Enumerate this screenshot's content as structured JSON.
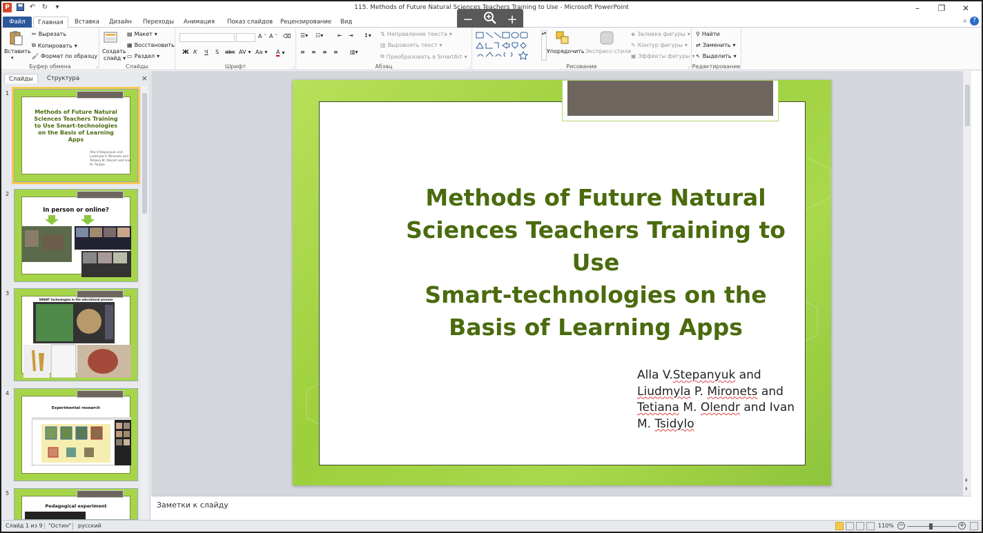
{
  "window": {
    "title": "115. Methods of Future Natural Sciences Teachers Training to Use - Microsoft PowerPoint",
    "app_icon": "P"
  },
  "zoom_overlay": {
    "minus": "−",
    "plus": "+"
  },
  "tabs": [
    "Файл",
    "Главная",
    "Вставка",
    "Дизайн",
    "Переходы",
    "Анимация",
    "Показ слайдов",
    "Рецензирование",
    "Вид"
  ],
  "ribbon": {
    "clipboard": {
      "label": "Буфер обмена",
      "paste": "Вставить",
      "cut": "Вырезать",
      "copy": "Копировать",
      "format_painter": "Формат по образцу"
    },
    "slides": {
      "label": "Слайды",
      "new_slide": "Создать",
      "new_slide_2": "слайд",
      "layout": "Макет",
      "reset": "Восстановить",
      "section": "Раздел"
    },
    "font": {
      "label": "Шрифт",
      "bold": "Ж",
      "italic": "К",
      "underline": "Ч",
      "strike": "S",
      "abc": "abc",
      "spacing": "AV",
      "case": "Aa"
    },
    "paragraph": {
      "label": "Абзац",
      "text_direction": "Направление текста",
      "align_text": "Выровнять текст",
      "smartart": "Преобразовать в SmartArt"
    },
    "drawing": {
      "label": "Рисование",
      "arrange": "Упорядочить",
      "quick_styles": "Экспресс-стили",
      "shape_fill": "Заливка фигуры",
      "shape_outline": "Контур фигуры",
      "shape_effects": "Эффекты фигуры"
    },
    "editing": {
      "label": "Редактирование",
      "find": "Найти",
      "replace": "Заменить",
      "select": "Выделить"
    }
  },
  "left_pane": {
    "tab_slides": "Слайды",
    "tab_outline": "Структура",
    "close": "×",
    "thumbnails": [
      {
        "num": "1",
        "title": "Methods of Future Natural Sciences Teachers Training to Use Smart-technologies on the Basis of Learning Apps",
        "sub": "Alla V.Stepanyuk and Liudmyla P. Mironets and Tetiana M. Olendr and Ivan M. Tsidylo"
      },
      {
        "num": "2",
        "title": "In person or online?"
      },
      {
        "num": "3",
        "title": "SMART technologies in the educational process"
      },
      {
        "num": "4",
        "title": "Experimental research"
      },
      {
        "num": "5",
        "title": "Pedagogical experiment"
      }
    ]
  },
  "slide": {
    "title_lines": [
      "Methods of Future Natural",
      "Sciences Teachers Training to",
      "Use",
      "Smart-technologies on the",
      "Basis of Learning Apps"
    ],
    "authors": {
      "l1a": "Alla V.",
      "l1b": "Stepanyuk",
      "l1c": " and",
      "l2a": "Liudmyla",
      "l2b": " P. ",
      "l2c": "Mironets",
      "l2d": " and",
      "l3a": "Tetiana",
      "l3b": " M. ",
      "l3c": "Olendr",
      "l3d": " and Ivan",
      "l4a": "M. ",
      "l4b": "Tsidylo"
    }
  },
  "notes": {
    "placeholder": "Заметки к слайду"
  },
  "status": {
    "slide_of": "Слайд 1 из 9",
    "theme": "\"Остин\"",
    "language": "русский",
    "zoom": "110%"
  }
}
